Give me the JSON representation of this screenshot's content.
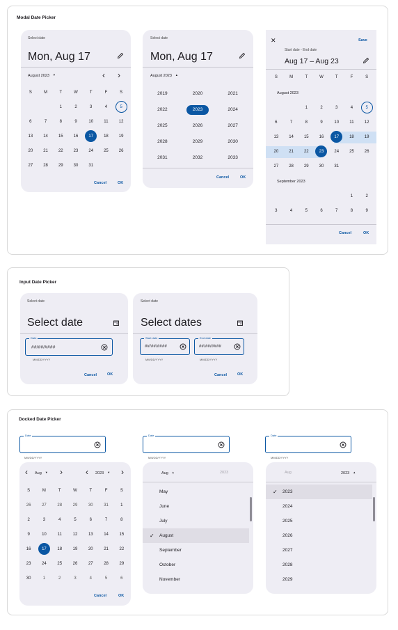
{
  "sections": {
    "modal": "Modal Date Picker",
    "input": "Input Date Picker",
    "docked": "Docked Date Picker"
  },
  "modal": {
    "calendar": {
      "label": "Select date",
      "date": "Mon, Aug 17",
      "month": "August 2023",
      "weekdays": [
        "S",
        "M",
        "T",
        "W",
        "T",
        "F",
        "S"
      ],
      "days": [
        "",
        "",
        "1",
        "2",
        "3",
        "4",
        "5",
        "6",
        "7",
        "8",
        "9",
        "10",
        "11",
        "12",
        "13",
        "14",
        "15",
        "16",
        "17",
        "18",
        "19",
        "20",
        "21",
        "22",
        "23",
        "24",
        "25",
        "26",
        "27",
        "28",
        "29",
        "30",
        "31",
        "",
        "",
        ""
      ],
      "selected": "17",
      "today": "5",
      "cancel": "Cancel",
      "ok": "OK"
    },
    "year": {
      "label": "Select date",
      "date": "Mon, Aug 17",
      "month": "August 2023",
      "years": [
        "2019",
        "2020",
        "2021",
        "2022",
        "2023",
        "2024",
        "2025",
        "2026",
        "2027",
        "2028",
        "2029",
        "2030",
        "2031",
        "2032",
        "2033"
      ],
      "selected": "2023",
      "cancel": "Cancel",
      "ok": "OK"
    },
    "range": {
      "close": "✕",
      "save": "Save",
      "label": "Start date - End date",
      "date": "Aug 17 – Aug 23",
      "weekdays": [
        "S",
        "M",
        "T",
        "W",
        "T",
        "F",
        "S"
      ],
      "month1": "August 2023",
      "days1": [
        "",
        "",
        "1",
        "2",
        "3",
        "4",
        "5",
        "6",
        "7",
        "8",
        "9",
        "10",
        "11",
        "12",
        "13",
        "14",
        "15",
        "16",
        "17",
        "18",
        "19",
        "20",
        "21",
        "22",
        "23",
        "24",
        "25",
        "26",
        "27",
        "28",
        "29",
        "30",
        "31",
        "",
        "",
        ""
      ],
      "month2": "September 2023",
      "days2": [
        "",
        "",
        "",
        "",
        "",
        "1",
        "2",
        "3",
        "4",
        "5",
        "6",
        "7",
        "8",
        "9"
      ],
      "cancel": "Cancel",
      "ok": "OK"
    }
  },
  "input": {
    "single": {
      "label": "Select date",
      "title": "Select date",
      "field_label": "Date",
      "field_value": "##/##/####",
      "support": "MM/DD/YYYY",
      "cancel": "Cancel",
      "ok": "OK"
    },
    "range": {
      "label": "Select date",
      "title": "Select dates",
      "start_label": "Start date",
      "end_label": "End date",
      "start_value": "##/##/####",
      "end_value": "##/##/####",
      "support_start": "MM/DD/YYYY",
      "support_end": "MM/DD/YYYY",
      "cancel": "Cancel",
      "ok": "OK"
    }
  },
  "docked": {
    "calendar": {
      "field_label": "Date",
      "support": "MM/DD/YYYY",
      "month": "Aug",
      "year": "2023",
      "weekdays": [
        "S",
        "M",
        "T",
        "W",
        "T",
        "F",
        "S"
      ],
      "days": [
        "26",
        "27",
        "28",
        "29",
        "30",
        "31",
        "1",
        "2",
        "3",
        "4",
        "5",
        "6",
        "7",
        "8",
        "9",
        "10",
        "11",
        "12",
        "13",
        "14",
        "15",
        "16",
        "17",
        "18",
        "19",
        "20",
        "21",
        "22",
        "23",
        "24",
        "25",
        "26",
        "27",
        "28",
        "29",
        "30",
        "1",
        "2",
        "3",
        "4",
        "5",
        "6"
      ],
      "selected": "17",
      "cancel": "Cancel",
      "ok": "OK"
    },
    "month_list": {
      "field_label": "Date",
      "support": "MM/DD/YYYY",
      "month": "Aug",
      "year": "2023",
      "months": [
        "May",
        "June",
        "July",
        "August",
        "September",
        "October",
        "November"
      ],
      "selected": "August"
    },
    "year_list": {
      "field_label": "Date",
      "support": "MM/DD/YYYY",
      "month": "Aug",
      "year": "2023",
      "years": [
        "2023",
        "2024",
        "2025",
        "2026",
        "2027",
        "2028",
        "2029"
      ],
      "selected": "2023"
    }
  }
}
